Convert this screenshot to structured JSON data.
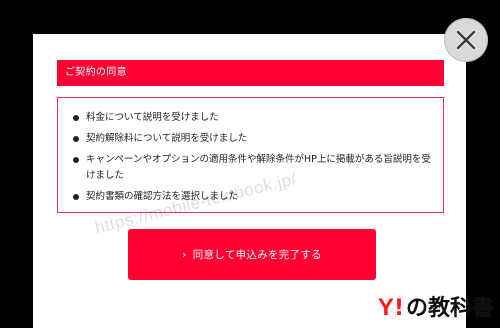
{
  "modal": {
    "section_title": "ご契約の同意",
    "checklist": [
      "料金について説明を受けました",
      "契約解除料について説明を受けました",
      "キャンペーンやオプションの適用条件や解除条件がHP上に掲載がある旨説明を受けました",
      "契約書類の確認方法を選択しました"
    ],
    "submit_label": "同意して申込みを完了する",
    "submit_chevron": "›"
  },
  "watermark": {
    "text": "https://mobile-textbook.jp/"
  },
  "logo": {
    "y": "Y",
    "bang": "!",
    "rest": "の教科書"
  },
  "colors": {
    "accent": "#ff0033",
    "border": "#e8384f",
    "overlay": "#000000",
    "close_bg": "#d9d9d9"
  },
  "icons": {
    "close": "close-icon",
    "bullet": "bullet-icon",
    "chevron": "chevron-right-icon"
  }
}
